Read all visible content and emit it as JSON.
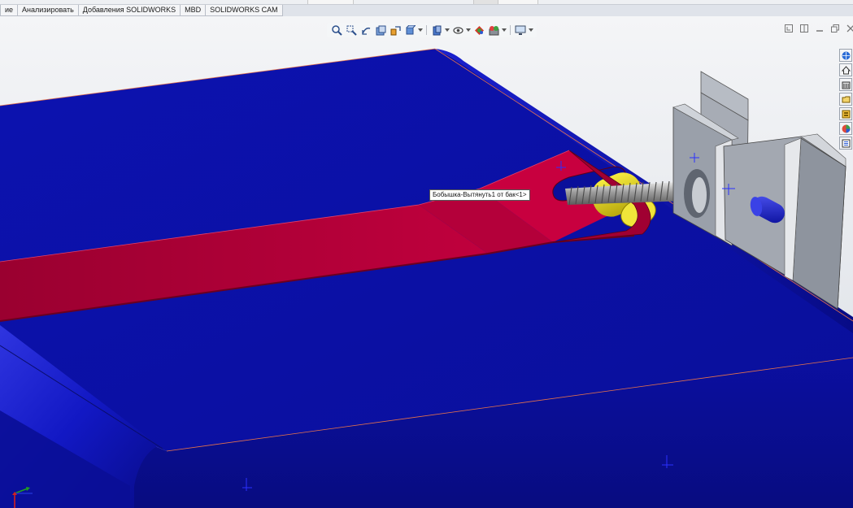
{
  "command_manager": {
    "tabs": [
      {
        "label": "ие"
      },
      {
        "label": "Анализировать"
      },
      {
        "label": "Добавления SOLIDWORKS"
      },
      {
        "label": "MBD"
      },
      {
        "label": "SOLIDWORKS CAM"
      }
    ]
  },
  "heads_up_toolbar": {
    "icons": [
      "zoom-to-fit-icon",
      "zoom-to-area-icon",
      "previous-view-icon",
      "section-view-icon",
      "dynamic-annotation-icon",
      "view-orientation-icon",
      "display-style-icon",
      "hide-show-icon",
      "edit-appearance-icon",
      "apply-scene-icon",
      "view-settings-icon"
    ]
  },
  "task_pane": {
    "icons": [
      "solidworks-resources-icon",
      "design-library-icon",
      "file-explorer-icon",
      "view-palette-icon",
      "document-properties-icon",
      "appearances-icon",
      "custom-properties-icon"
    ]
  },
  "tooltip": {
    "text": "Бобышка-Вытянуть1 от бак<1>"
  },
  "colors": {
    "tank_body": "#0a0fa8",
    "strap": "#b8003a",
    "bracket": "#9da3ad",
    "cylinder": "#e6da1c",
    "viewport_background": "#e4e7ec"
  }
}
